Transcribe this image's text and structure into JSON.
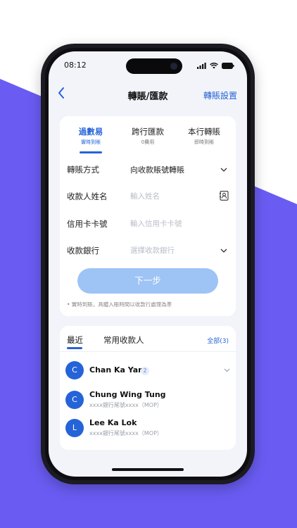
{
  "colors": {
    "accent": "#2563d8",
    "purple": "#6a5cf3",
    "button_disabled": "#9ec3f5"
  },
  "status": {
    "time": "08:12"
  },
  "nav": {
    "back_icon": "chevron-left-icon",
    "title": "轉賬/匯款",
    "right": "轉賬設置"
  },
  "tabs": [
    {
      "label": "過數易",
      "sub": "實時到賬"
    },
    {
      "label": "跨行匯款",
      "sub": "0費用"
    },
    {
      "label": "本行轉賬",
      "sub": "即時到賬"
    }
  ],
  "form": {
    "method": {
      "label": "轉賬方式",
      "value": "向收款賬號轉賬"
    },
    "payee": {
      "label": "收款人姓名",
      "placeholder": "輸入姓名"
    },
    "card": {
      "label": "信用卡卡號",
      "placeholder": "輸入信用卡卡號"
    },
    "bank": {
      "label": "收款銀行",
      "placeholder": "選擇收款銀行"
    },
    "next": "下一步",
    "note": "• 實時到賬，具體入賬時間以收款行處理為準"
  },
  "contacts": {
    "tab_recent": "最近",
    "tab_frequent": "常用收款人",
    "all": "全部(3)",
    "items": [
      {
        "initial": "C",
        "name": "Chan Ka Yan",
        "badge": "2",
        "sub": ""
      },
      {
        "initial": "C",
        "name": "Chung Wing Tung",
        "sub": "xxxx銀行尾號xxxx（MOP）"
      },
      {
        "initial": "L",
        "name": "Lee Ka Lok",
        "sub": "xxxx銀行尾號xxxx（MOP）"
      }
    ]
  }
}
